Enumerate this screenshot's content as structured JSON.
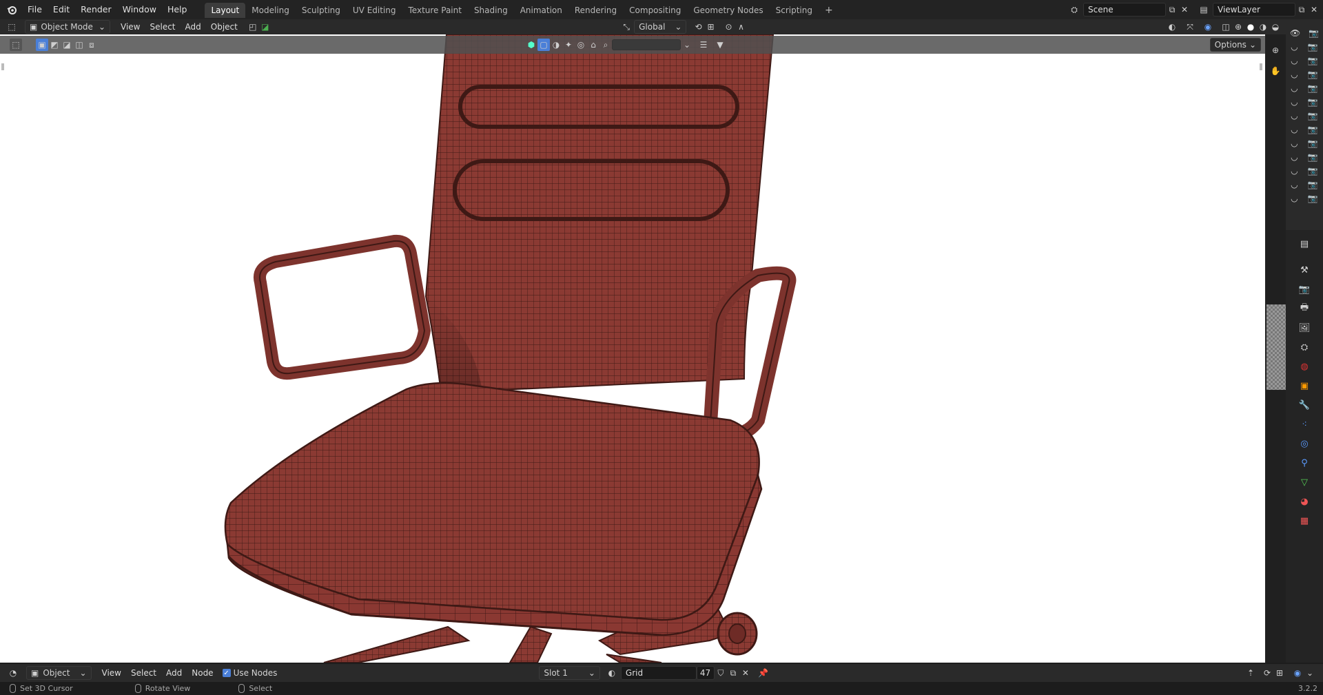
{
  "topbar": {
    "menus": [
      "File",
      "Edit",
      "Render",
      "Window",
      "Help"
    ],
    "workspaces": [
      "Layout",
      "Modeling",
      "Sculpting",
      "UV Editing",
      "Texture Paint",
      "Shading",
      "Animation",
      "Rendering",
      "Compositing",
      "Geometry Nodes",
      "Scripting"
    ],
    "active_workspace": "Layout",
    "add_workspace": "+",
    "scene": "Scene",
    "view_layer": "ViewLayer"
  },
  "view_header": {
    "mode": "Object Mode",
    "menus": [
      "View",
      "Select",
      "Add",
      "Object"
    ],
    "orientation": "Global",
    "options": "Options"
  },
  "bottom_bar": {
    "editor": "Object",
    "menus": [
      "View",
      "Select",
      "Add",
      "Node"
    ],
    "use_nodes_label": "Use Nodes",
    "slot": "Slot 1",
    "material": "Grid",
    "users": "47"
  },
  "status_bar": {
    "items": [
      "Set 3D Cursor",
      "Rotate View",
      "Select"
    ],
    "version": "3.2.2"
  },
  "colors": {
    "mesh": "#8b3a33",
    "wire": "#3b1a16",
    "accent": "#4a7fd8"
  }
}
